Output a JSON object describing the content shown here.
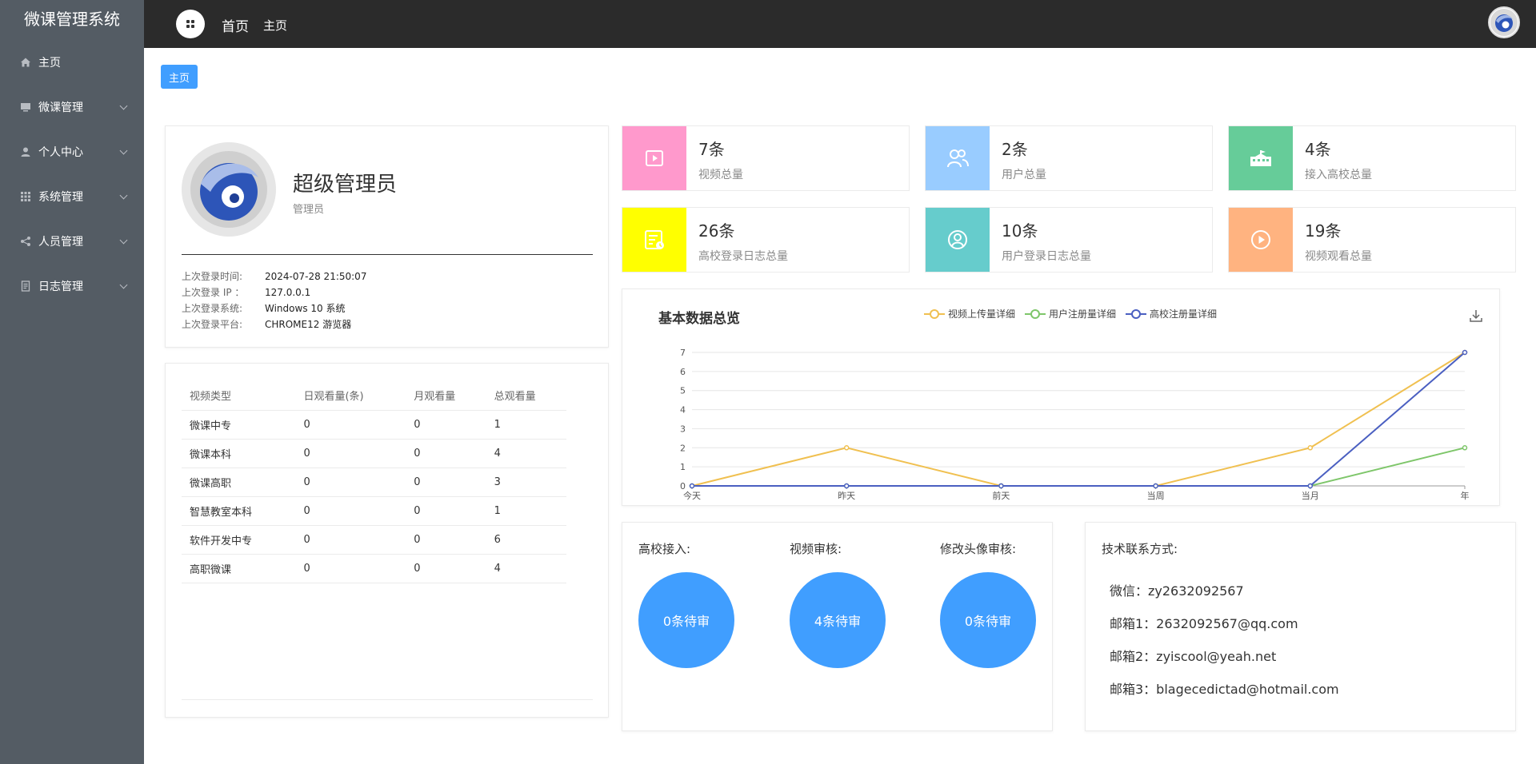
{
  "app": {
    "title": "微课管理系统"
  },
  "sidebar": {
    "items": [
      {
        "label": "主页",
        "icon": "home-icon"
      },
      {
        "label": "微课管理",
        "icon": "monitor-icon"
      },
      {
        "label": "个人中心",
        "icon": "user-icon"
      },
      {
        "label": "系统管理",
        "icon": "grid-icon"
      },
      {
        "label": "人员管理",
        "icon": "share-icon"
      },
      {
        "label": "日志管理",
        "icon": "document-icon"
      }
    ]
  },
  "header": {
    "title": "首页",
    "breadcrumb": "主页"
  },
  "tag": {
    "label": "主页"
  },
  "profile": {
    "name": "超级管理员",
    "role": "管理员",
    "info": [
      {
        "key": "上次登录时间:",
        "value": "2024-07-28 21:50:07"
      },
      {
        "key": "上次登录 IP ：",
        "value": "127.0.0.1"
      },
      {
        "key": "上次登录系统:",
        "value": "Windows 10 系统"
      },
      {
        "key": "上次登录平台:",
        "value": "CHROME12 游览器"
      }
    ]
  },
  "views_table": {
    "headers": [
      "视频类型",
      "日观看量(条)",
      "月观看量",
      "总观看量"
    ],
    "rows": [
      [
        "微课中专",
        "0",
        "0",
        "1"
      ],
      [
        "微课本科",
        "0",
        "0",
        "4"
      ],
      [
        "微课高职",
        "0",
        "0",
        "3"
      ],
      [
        "智慧教室本科",
        "0",
        "0",
        "1"
      ],
      [
        "软件开发中专",
        "0",
        "0",
        "6"
      ],
      [
        "高职微课",
        "0",
        "0",
        "4"
      ]
    ]
  },
  "stats": [
    {
      "value": "7条",
      "label": "视频总量",
      "color": "#ff99cc",
      "icon": "video-icon"
    },
    {
      "value": "2条",
      "label": "用户总量",
      "color": "#99ccff",
      "icon": "users-icon"
    },
    {
      "value": "4条",
      "label": "接入高校总量",
      "color": "#66cc99",
      "icon": "school-icon"
    },
    {
      "value": "26条",
      "label": "高校登录日志总量",
      "color": "#ffff00",
      "icon": "log-icon"
    },
    {
      "value": "10条",
      "label": "用户登录日志总量",
      "color": "#66cccc",
      "icon": "user-circle-icon"
    },
    {
      "value": "19条",
      "label": "视频观看总量",
      "color": "#ffb380",
      "icon": "play-icon"
    }
  ],
  "chart_data": {
    "type": "line",
    "title": "基本数据总览",
    "categories": [
      "今天",
      "昨天",
      "前天",
      "当周",
      "当月",
      "年"
    ],
    "ylim": [
      0,
      7
    ],
    "yticks": [
      0,
      1,
      2,
      3,
      4,
      5,
      6,
      7
    ],
    "grid": true,
    "legend": "top-center",
    "series": [
      {
        "name": "视频上传量详细",
        "values": [
          0,
          2,
          0,
          0,
          2,
          7
        ],
        "color": "#f0c050"
      },
      {
        "name": "用户注册量详细",
        "values": [
          0,
          0,
          0,
          0,
          0,
          2
        ],
        "color": "#7ec66a"
      },
      {
        "name": "高校注册量详细",
        "values": [
          0,
          0,
          0,
          0,
          0,
          7
        ],
        "color": "#4a5fc1"
      }
    ]
  },
  "review": [
    {
      "label": "高校接入:",
      "value": "0条待审"
    },
    {
      "label": "视频审核:",
      "value": "4条待审"
    },
    {
      "label": "修改头像审核:",
      "value": "0条待审"
    }
  ],
  "contact": {
    "title": "技术联系方式:",
    "lines": [
      "微信：zy2632092567",
      "邮箱1：2632092567@qq.com",
      "邮箱2：zyiscool@yeah.net",
      "邮箱3：blagecedictad@hotmail.com"
    ]
  },
  "colors": {
    "accent": "#409eff",
    "sidebar": "#545c64",
    "header": "#2b2b2b"
  }
}
